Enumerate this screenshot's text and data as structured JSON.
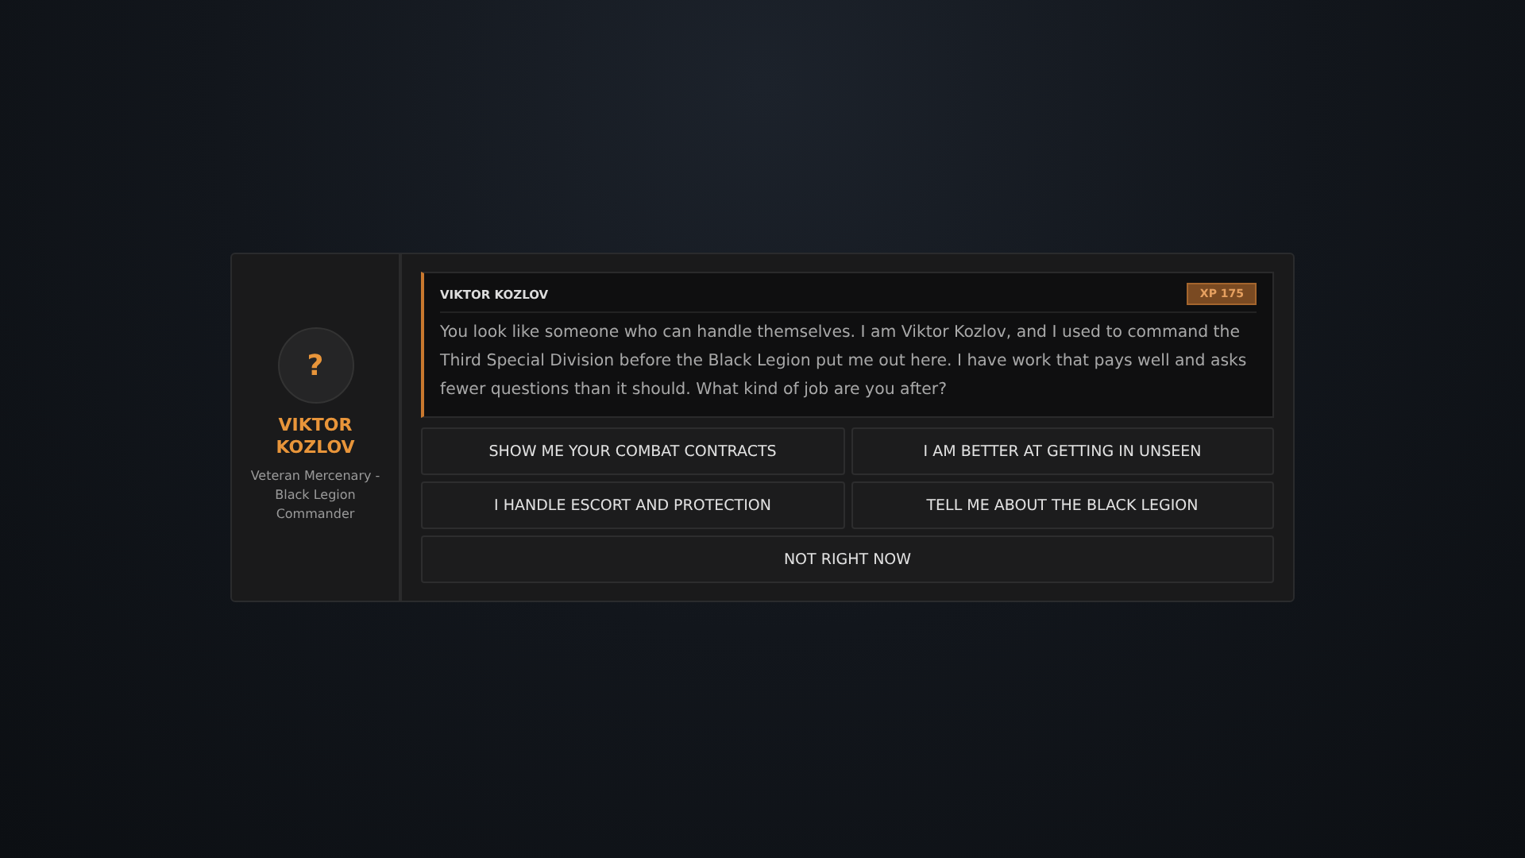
{
  "npc": {
    "avatar": "?",
    "name": "VIKTOR KOZLOV",
    "title": "Veteran Mercenary - Black Legion Commander"
  },
  "dialogue": {
    "speaker": "VIKTOR KOZLOV",
    "xp": "XP 175",
    "text": "You look like someone who can handle themselves. I am Viktor Kozlov, and I used to command the Third Special Division before the Black Legion put me out here. I have work that pays well and asks fewer questions than it should. What kind of job are you after?"
  },
  "options": [
    {
      "label": "SHOW ME YOUR COMBAT CONTRACTS",
      "kind": "half"
    },
    {
      "label": "I AM BETTER AT GETTING IN UNSEEN",
      "kind": "half"
    },
    {
      "label": "I HANDLE ESCORT AND PROTECTION",
      "kind": "half"
    },
    {
      "label": "TELL ME ABOUT THE BLACK LEGION",
      "kind": "half"
    },
    {
      "label": "NOT RIGHT NOW",
      "kind": "full"
    }
  ]
}
